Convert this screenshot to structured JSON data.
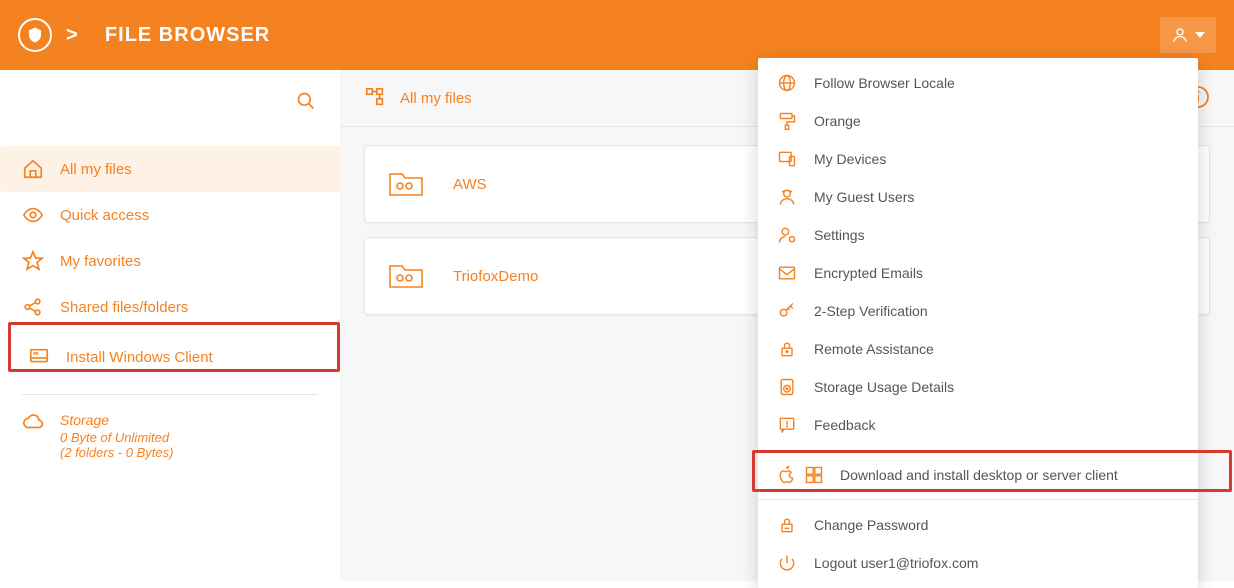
{
  "header": {
    "separator": ">",
    "title": "FILE BROWSER"
  },
  "sidebar": {
    "items": [
      {
        "label": "All my files"
      },
      {
        "label": "Quick access"
      },
      {
        "label": "My favorites"
      },
      {
        "label": "Shared files/folders"
      },
      {
        "label": "Install Windows Client"
      }
    ],
    "storage": {
      "title": "Storage",
      "line1": "0 Byte of Unlimited",
      "line2": "(2 folders - 0 Bytes)"
    }
  },
  "content": {
    "title": "All my files",
    "folders": [
      {
        "name": "AWS"
      },
      {
        "name": "TriofoxDemo"
      }
    ]
  },
  "dropdown": {
    "items": [
      {
        "label": "Follow Browser Locale"
      },
      {
        "label": "Orange"
      },
      {
        "label": "My Devices"
      },
      {
        "label": "My Guest Users"
      },
      {
        "label": "Settings"
      },
      {
        "label": "Encrypted Emails"
      },
      {
        "label": "2-Step Verification"
      },
      {
        "label": "Remote Assistance"
      },
      {
        "label": "Storage Usage Details"
      },
      {
        "label": "Feedback"
      }
    ],
    "download": {
      "label": "Download and install desktop or server client"
    },
    "changePassword": {
      "label": "Change Password"
    },
    "logout": {
      "label": "Logout user1@triofox.com"
    }
  }
}
